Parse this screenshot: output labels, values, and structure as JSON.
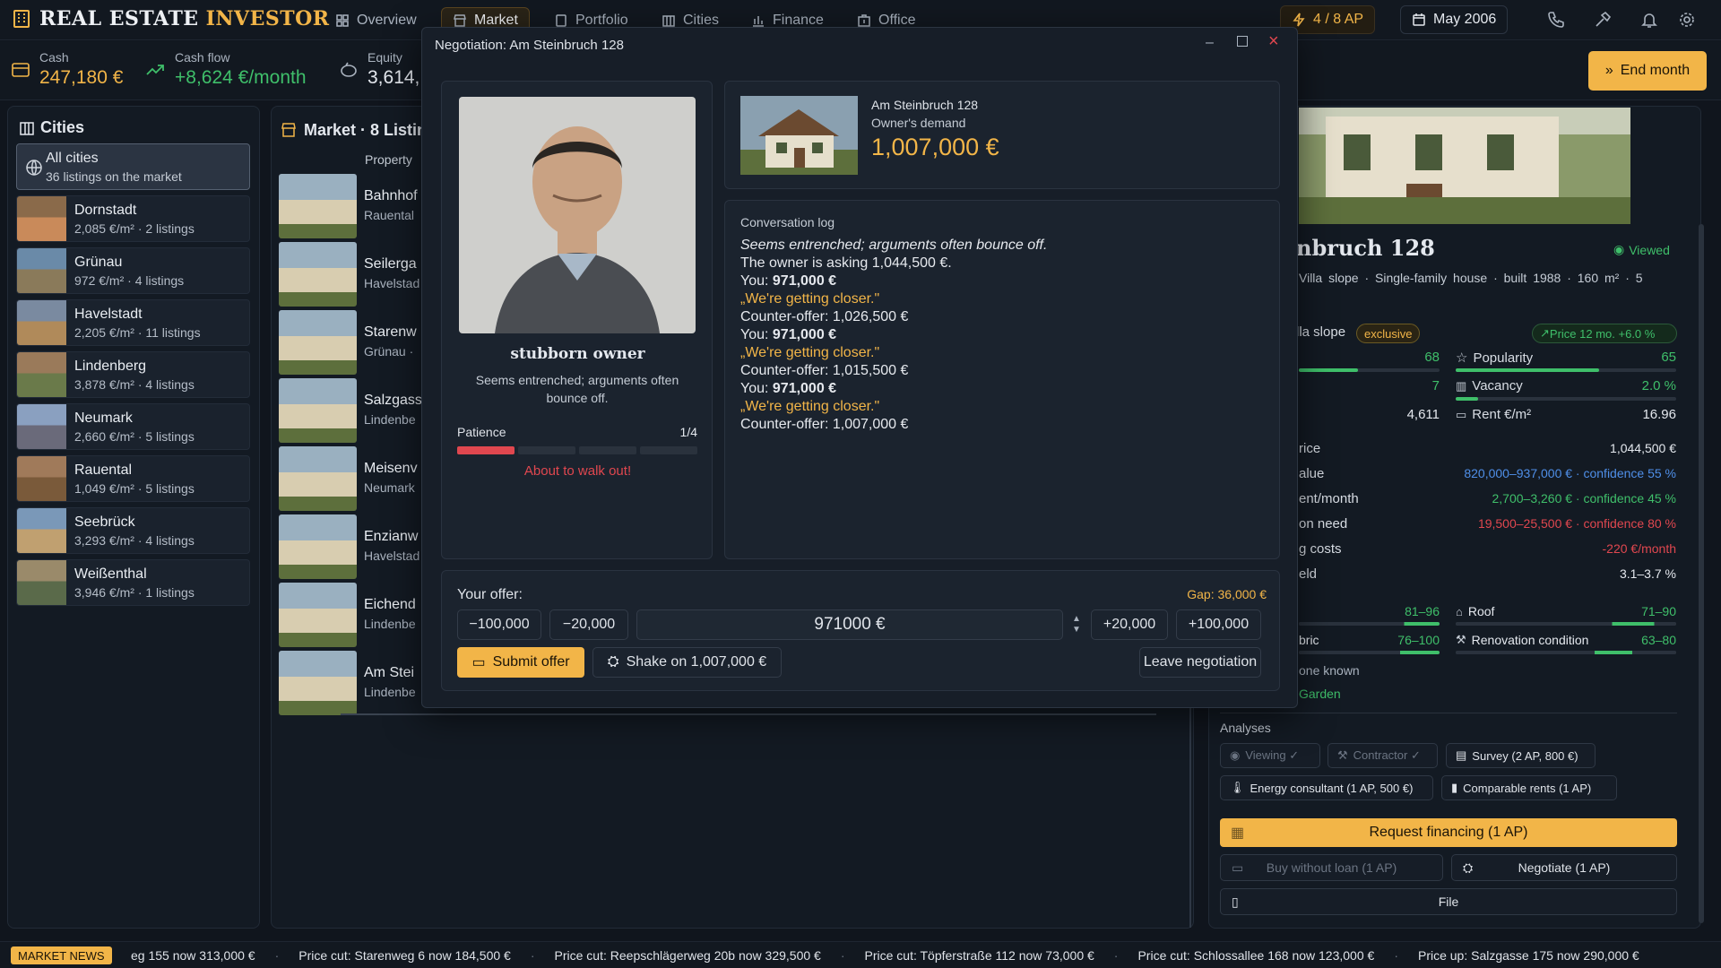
{
  "app": {
    "title_part1": "REAL ESTATE",
    "title_part2": "INVESTOR"
  },
  "nav": [
    {
      "label": "Overview",
      "icon": "grid-icon"
    },
    {
      "label": "Market",
      "icon": "store-icon"
    },
    {
      "label": "Portfolio",
      "icon": "briefcase-icon"
    },
    {
      "label": "Cities",
      "icon": "building-icon"
    },
    {
      "label": "Finance",
      "icon": "chart-icon"
    },
    {
      "label": "Office",
      "icon": "office-icon"
    }
  ],
  "ap": "4 / 8 AP",
  "date": "May 2006",
  "stats": {
    "cash_label": "Cash",
    "cash_value": "247,180 €",
    "cashflow_label": "Cash flow",
    "cashflow_value": "+8,624 €/month",
    "equity_label": "Equity",
    "equity_value": "3,614,"
  },
  "end_month": "End month",
  "cities": {
    "title": "Cities",
    "all_title": "All cities",
    "all_sub": "36 listings on the market",
    "items": [
      {
        "name": "Dornstadt",
        "sub": "2,085 €/m² · 2 listings"
      },
      {
        "name": "Grünau",
        "sub": "972 €/m² · 4 listings"
      },
      {
        "name": "Havelstadt",
        "sub": "2,205 €/m² · 11 listings"
      },
      {
        "name": "Lindenberg",
        "sub": "3,878 €/m² · 4 listings"
      },
      {
        "name": "Neumark",
        "sub": "2,660 €/m² · 5 listings"
      },
      {
        "name": "Rauental",
        "sub": "1,049 €/m² · 5 listings"
      },
      {
        "name": "Seebrück",
        "sub": "3,293 €/m² · 4 listings"
      },
      {
        "name": "Weißenthal",
        "sub": "3,946 €/m² · 1 listings"
      }
    ]
  },
  "market": {
    "title": "Market · 8 Listin",
    "col_property": "Property",
    "listings": [
      {
        "name": "Bahnhof",
        "sub": "Rauental"
      },
      {
        "name": "Seilerga",
        "sub": "Havelstad"
      },
      {
        "name": "Starenw",
        "sub": "Grünau ·"
      },
      {
        "name": "Salzgass",
        "sub": "Lindenbe"
      },
      {
        "name": "Meisenv",
        "sub": "Neumark"
      },
      {
        "name": "Enzianw",
        "sub": "Havelstad"
      },
      {
        "name": "Eichend",
        "sub": "Lindenbe"
      },
      {
        "name": "Am Stei",
        "sub": "Lindenbe"
      }
    ]
  },
  "detail": {
    "title": "nbruch 128",
    "viewed": "Viewed",
    "meta": "Villa slope · Single-family house · built 1988 · 160 m² · 5",
    "district": "lla slope",
    "badge": "exclusive",
    "trend": "Price 12 mo. +6.0 %",
    "left_vals": [
      "68",
      "7",
      "4,611"
    ],
    "left_fill": [
      0.42,
      0.0,
      0.0
    ],
    "popularity_label": "Popularity",
    "popularity_value": "65",
    "popularity_fill": 0.65,
    "vacancy_label": "Vacancy",
    "vacancy_value": "2.0 %",
    "vacancy_fill": 0.1,
    "rent_label": "Rent €/m²",
    "rent_value": "16.96",
    "rows": [
      {
        "label": "rice",
        "value": "1,044,500 €",
        "color": "#e4e8ee"
      },
      {
        "label": "alue",
        "value": "820,000–937,000 € · confidence 55 %",
        "color": "#4f8fe8"
      },
      {
        "label": "ent/month",
        "value": "2,700–3,260 € · confidence 45 %",
        "color": "#3fbf6a"
      },
      {
        "label": "on need",
        "value": "19,500–25,500 € · confidence 80 %",
        "color": "#e0474f"
      },
      {
        "label": "g costs",
        "value": "-220 €/month",
        "color": "#e0474f"
      },
      {
        "label": "eld",
        "value": "3.1–3.7 %",
        "color": "#e4e8ee"
      }
    ],
    "cond1_value": "81–96",
    "roof_label": "Roof",
    "roof_value": "71–90",
    "fabric_label": "bric",
    "fabric_value": "76–100",
    "renov_label": "Renovation condition",
    "renov_value": "63–80",
    "none_known": "one known",
    "garden": "Garden",
    "analyses_title": "Analyses",
    "viewing": "Viewing ✓",
    "contractor": "Contractor ✓",
    "survey": "Survey (2 AP, 800 €)",
    "energy": "Energy consultant (1 AP, 500 €)",
    "comparable": "Comparable rents (1 AP)",
    "request_financing": "Request financing (1 AP)",
    "buy_without": "Buy without loan (1 AP)",
    "negotiate": "Negotiate (1 AP)",
    "file": "File"
  },
  "dialog": {
    "title": "Negotiation: Am Steinbruch 128",
    "owner_type": "stubborn owner",
    "owner_desc": "Seems entrenched; arguments often bounce off.",
    "patience_label": "Patience",
    "patience_value": "1/4",
    "patience_level": 0.25,
    "warning": "About to walk out!",
    "property_name": "Am Steinbruch 128",
    "demand_label": "Owner's demand",
    "demand_value": "1,007,000 €",
    "log_title": "Conversation log",
    "log": [
      {
        "t": "Seems entrenched; arguments often bounce off.",
        "s": "it"
      },
      {
        "t": "The owner is asking 1,044,500 €.",
        "s": ""
      },
      {
        "p": "You: ",
        "b": "971,000 €",
        "s": "you"
      },
      {
        "t": "„We're getting closer.\"",
        "s": "q"
      },
      {
        "t": "Counter-offer: 1,026,500 €",
        "s": ""
      },
      {
        "p": "You: ",
        "b": "971,000 €",
        "s": "you"
      },
      {
        "t": "„We're getting closer.\"",
        "s": "q"
      },
      {
        "t": "Counter-offer: 1,015,500 €",
        "s": ""
      },
      {
        "p": "You: ",
        "b": "971,000 €",
        "s": "you"
      },
      {
        "t": "„We're getting closer.\"",
        "s": "q"
      },
      {
        "t": "Counter-offer: 1,007,000 €",
        "s": ""
      }
    ],
    "offer_label": "Your offer:",
    "gap": "Gap: 36,000 €",
    "m100": "−100,000",
    "m20": "−20,000",
    "offer_value": "971000 €",
    "p20": "+20,000",
    "p100": "+100,000",
    "submit": "Submit offer",
    "shake": "Shake on 1,007,000 €",
    "leave": "Leave negotiation"
  },
  "news": {
    "label": "MARKET NEWS",
    "items": [
      "eg 155 now 313,000 €",
      "Price cut: Starenweg 6 now 184,500 €",
      "Price cut: Reepschlägerweg 20b now 329,500 €",
      "Price cut: Töpferstraße 112 now 73,000 €",
      "Price cut: Schlossallee 168 now 123,000 €",
      "Price up: Salzgasse 175 now 290,000 €"
    ]
  },
  "colors": {
    "accent": "#f2b548",
    "green": "#3fbf6a",
    "red": "#e0474f",
    "blue": "#4f8fe8"
  }
}
